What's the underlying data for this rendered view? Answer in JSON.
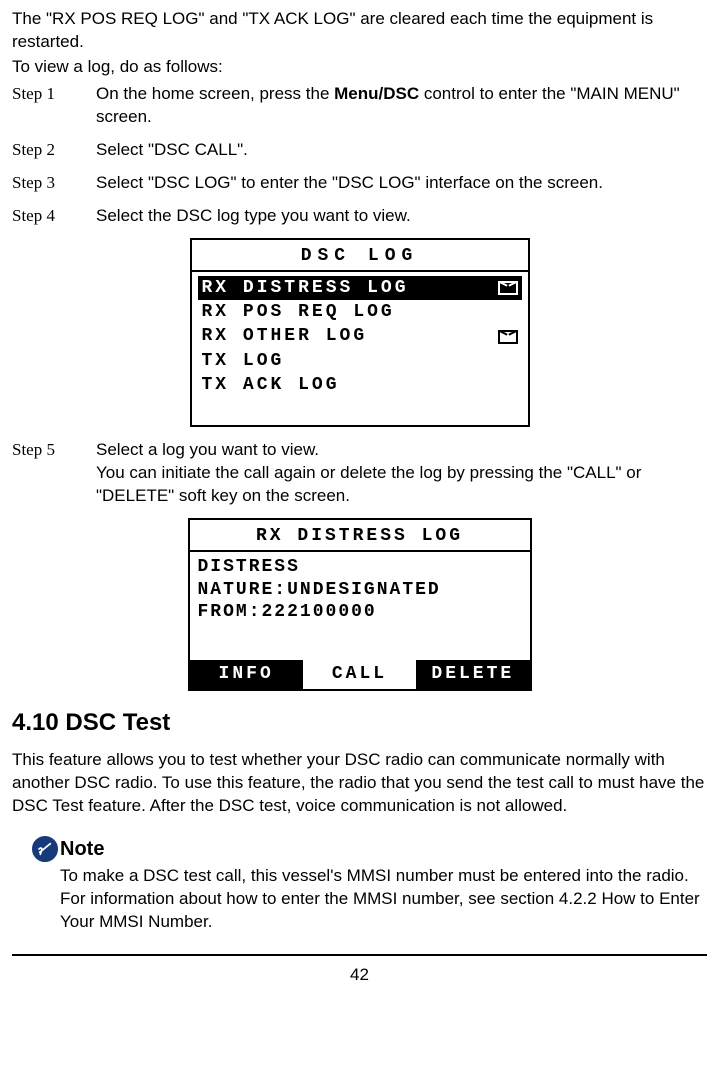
{
  "intro": {
    "line1": "The \"RX POS REQ LOG\" and \"TX ACK LOG\" are cleared each time the equipment is restarted.",
    "line2": "To view a log, do as follows:"
  },
  "steps": [
    {
      "label": "Step 1",
      "text_pre": "On the home screen, press the ",
      "bold": "Menu/DSC",
      "text_post": " control to enter the \"MAIN MENU\" screen."
    },
    {
      "label": "Step 2",
      "text_pre": "Select \"DSC CALL\".",
      "bold": "",
      "text_post": ""
    },
    {
      "label": "Step 3",
      "text_pre": "Select \"DSC LOG\" to enter the \"DSC LOG\" interface on the screen.",
      "bold": "",
      "text_post": ""
    },
    {
      "label": "Step 4",
      "text_pre": "Select the DSC log type you want to view.",
      "bold": "",
      "text_post": ""
    }
  ],
  "lcd1": {
    "title": "DSC LOG",
    "rows": [
      {
        "text": "RX DISTRESS LOG",
        "selected": true,
        "env": true
      },
      {
        "text": "RX POS REQ LOG",
        "selected": false,
        "env": false
      },
      {
        "text": "RX OTHER LOG",
        "selected": false,
        "env": true
      },
      {
        "text": "TX LOG",
        "selected": false,
        "env": false
      },
      {
        "text": "TX ACK LOG",
        "selected": false,
        "env": false
      }
    ]
  },
  "step5": {
    "label": "Step 5",
    "line1": "Select a log you want to view.",
    "line2": "You can initiate the call again or delete the log by pressing the \"CALL\" or \"DELETE\" soft key on the screen."
  },
  "lcd2": {
    "title": "RX DISTRESS LOG",
    "body": [
      "DISTRESS",
      "NATURE:UNDESIGNATED",
      "FROM:222100000"
    ],
    "footer": [
      "INFO",
      "CALL",
      "DELETE"
    ]
  },
  "section": {
    "heading": "4.10 DSC Test",
    "body": "This feature allows you to test whether your DSC radio can communicate normally with another DSC radio. To use this feature, the radio that you send the test call to must have the DSC Test feature. After the DSC test, voice communication is not allowed."
  },
  "note": {
    "label": "Note",
    "body": "To make a DSC test call, this vessel's MMSI number must be entered into the radio. For information about how to enter the MMSI number, see section 4.2.2 How to Enter Your MMSI Number."
  },
  "page_number": "42"
}
